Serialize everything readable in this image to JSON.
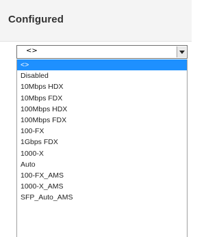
{
  "header": {
    "title": "Configured"
  },
  "select": {
    "value": "<>",
    "options": [
      "<>",
      "Disabled",
      "10Mbps HDX",
      "10Mbps FDX",
      "100Mbps HDX",
      "100Mbps FDX",
      "100-FX",
      "1Gbps FDX",
      "1000-X",
      "Auto",
      "100-FX_AMS",
      "1000-X_AMS",
      "SFP_Auto_AMS"
    ],
    "selected_index": 0
  },
  "colors": {
    "highlight": "#1e90ff",
    "header_bg": "#f4f4f4"
  }
}
